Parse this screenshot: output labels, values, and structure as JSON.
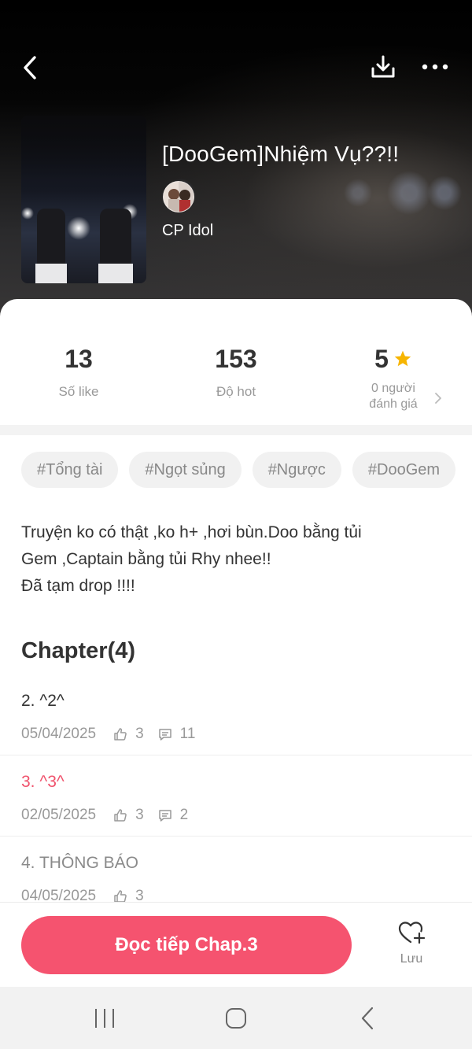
{
  "header": {
    "back_icon": "chevron-left-icon",
    "download_icon": "download-icon",
    "more_icon": "more-horizontal-icon"
  },
  "book": {
    "title": "[DooGem]Nhiệm Vụ??!!",
    "author": "CP Idol"
  },
  "stats": {
    "likes": {
      "value": "13",
      "label": "Số like"
    },
    "hot": {
      "value": "153",
      "label": "Độ hot"
    },
    "rating": {
      "value": "5",
      "raters_line1": "0 người",
      "raters_line2": "đánh giá"
    }
  },
  "tags": [
    "#Tổng tài",
    "#Ngọt sủng",
    "#Ngược",
    "#DooGem"
  ],
  "description": {
    "line1": "Truyện ko có thật ,ko h+ ,hơi bùn.Doo bằng tủi",
    "line2": "Gem ,Captain bằng tủi Rhy nhee!!",
    "line3": "Đã tạm drop !!!!"
  },
  "chapters_heading": "Chapter(4)",
  "chapters": [
    {
      "title": "2. ^2^",
      "date": "05/04/2025",
      "likes": "3",
      "comments": "11",
      "state": "normal"
    },
    {
      "title": "3. ^3^",
      "date": "02/05/2025",
      "likes": "3",
      "comments": "2",
      "state": "current"
    },
    {
      "title": "4. THÔNG BÁO",
      "date": "04/05/2025",
      "likes": "3",
      "comments": "",
      "state": "read"
    }
  ],
  "bottom": {
    "continue_label": "Đọc tiếp Chap.3",
    "save_label": "Lưu"
  },
  "colors": {
    "accent": "#f5536f",
    "current_chapter": "#f0536d",
    "star": "#f7b500"
  }
}
